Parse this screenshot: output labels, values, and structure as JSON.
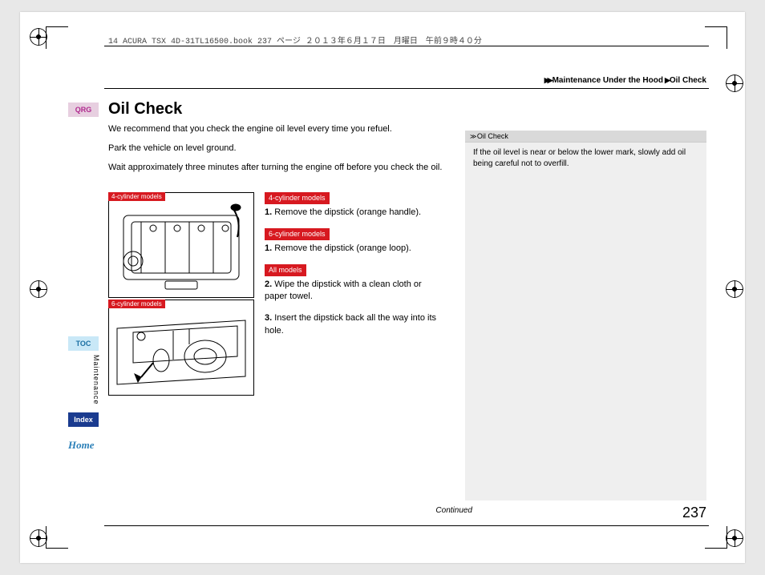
{
  "header": {
    "source_line": "14 ACURA TSX 4D-31TL16500.book  237 ページ  ２０１３年６月１７日　月曜日　午前９時４０分"
  },
  "breadcrumb": {
    "level1": "Maintenance Under the Hood",
    "level2": "Oil Check"
  },
  "nav": {
    "qrg": "QRG",
    "toc": "TOC",
    "index": "Index",
    "home": "Home",
    "section_vertical": "Maintenance"
  },
  "title": "Oil Check",
  "paragraphs": {
    "p1": "We recommend that you check the engine oil level every time you refuel.",
    "p2": "Park the vehicle on level ground.",
    "p3": "Wait approximately three minutes after turning the engine off before you check the oil."
  },
  "figures": {
    "fig1_label": "4-cylinder models",
    "fig2_label": "6-cylinder models"
  },
  "steps": {
    "badge_4cyl": "4-cylinder models",
    "step1_4": "Remove the dipstick (orange handle).",
    "badge_6cyl": "6-cylinder models",
    "step1_6": "Remove the dipstick (orange loop).",
    "badge_all": "All models",
    "step2": "Wipe the dipstick with a clean cloth or paper towel.",
    "step3": "Insert the dipstick back all the way into its hole."
  },
  "sidebar": {
    "heading": "Oil Check",
    "body": "If the oil level is near or below the lower mark, slowly add oil being careful not to overfill."
  },
  "footer": {
    "continued": "Continued",
    "page": "237"
  }
}
